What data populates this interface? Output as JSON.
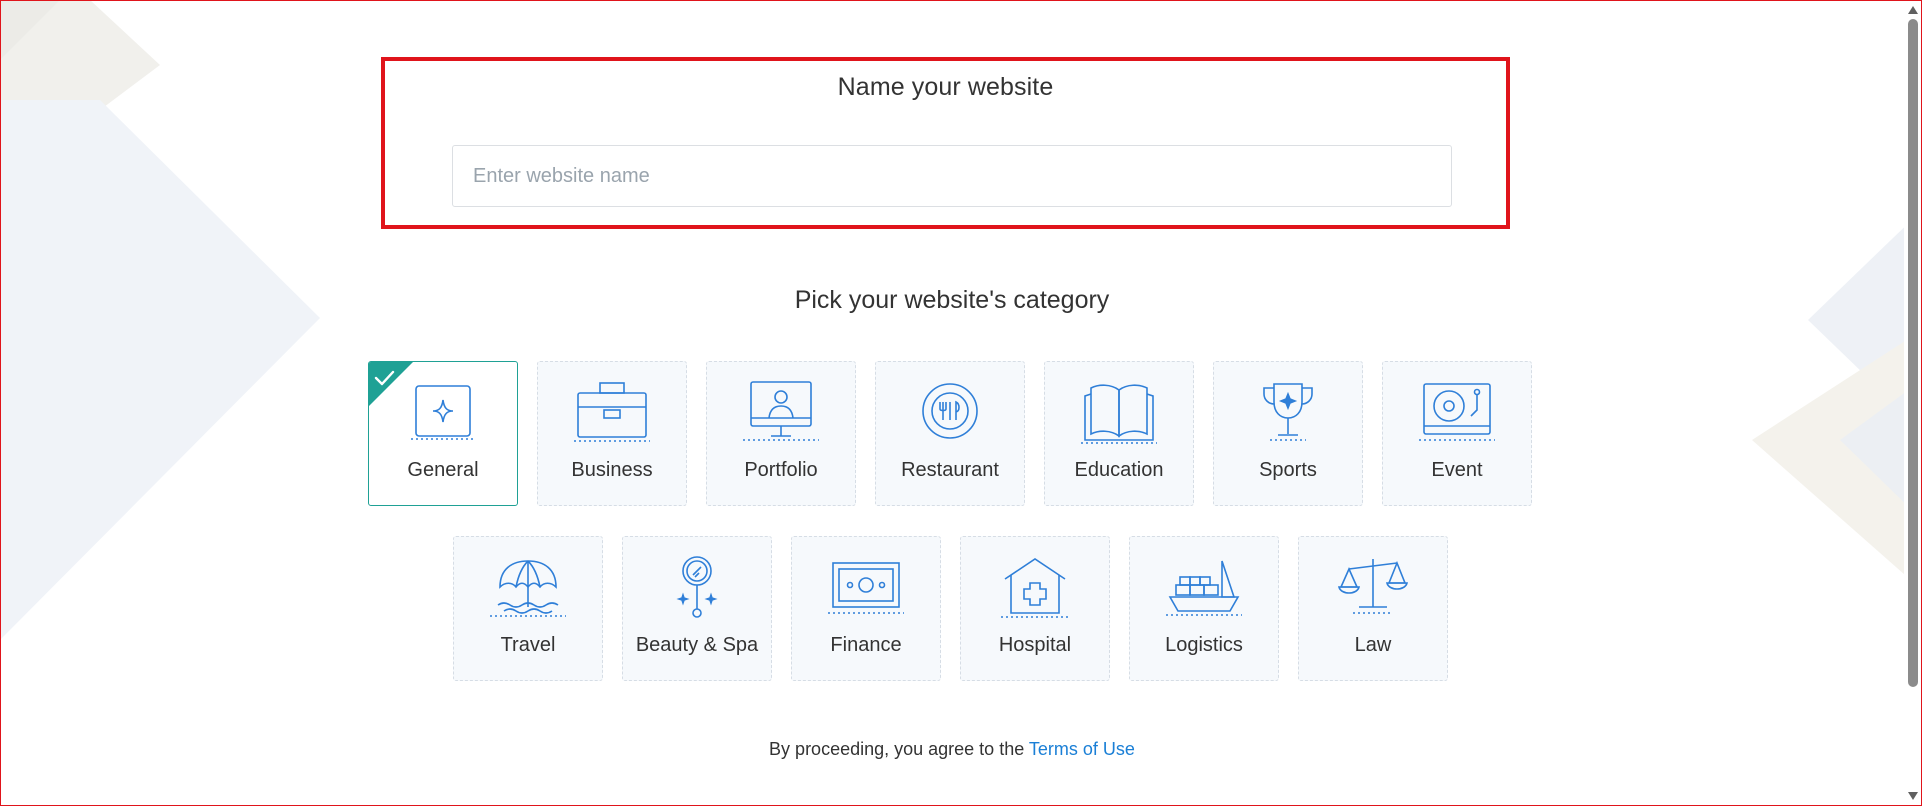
{
  "name_section": {
    "title": "Name your website",
    "input_placeholder": "Enter website name",
    "input_value": ""
  },
  "category_section": {
    "title": "Pick your website's category",
    "selected": "General",
    "row1": [
      {
        "label": "General",
        "icon": "sparkle-frame-icon"
      },
      {
        "label": "Business",
        "icon": "briefcase-icon"
      },
      {
        "label": "Portfolio",
        "icon": "monitor-person-icon"
      },
      {
        "label": "Restaurant",
        "icon": "plate-fork-icon"
      },
      {
        "label": "Education",
        "icon": "open-book-icon"
      },
      {
        "label": "Sports",
        "icon": "trophy-icon"
      },
      {
        "label": "Event",
        "icon": "turntable-icon"
      }
    ],
    "row2": [
      {
        "label": "Travel",
        "icon": "beach-umbrella-icon"
      },
      {
        "label": "Beauty & Spa",
        "icon": "hand-mirror-icon"
      },
      {
        "label": "Finance",
        "icon": "banknote-icon"
      },
      {
        "label": "Hospital",
        "icon": "hospital-icon"
      },
      {
        "label": "Logistics",
        "icon": "cargo-ship-icon"
      },
      {
        "label": "Law",
        "icon": "scales-icon"
      }
    ]
  },
  "footer": {
    "terms_prefix": "By proceeding, you agree to the",
    "terms_link": "Terms of Use"
  },
  "colors": {
    "accent_teal": "#1fa195",
    "icon_blue": "#2f7fd8",
    "link_blue": "#1a7fd6",
    "highlight_red": "#e0141b"
  }
}
